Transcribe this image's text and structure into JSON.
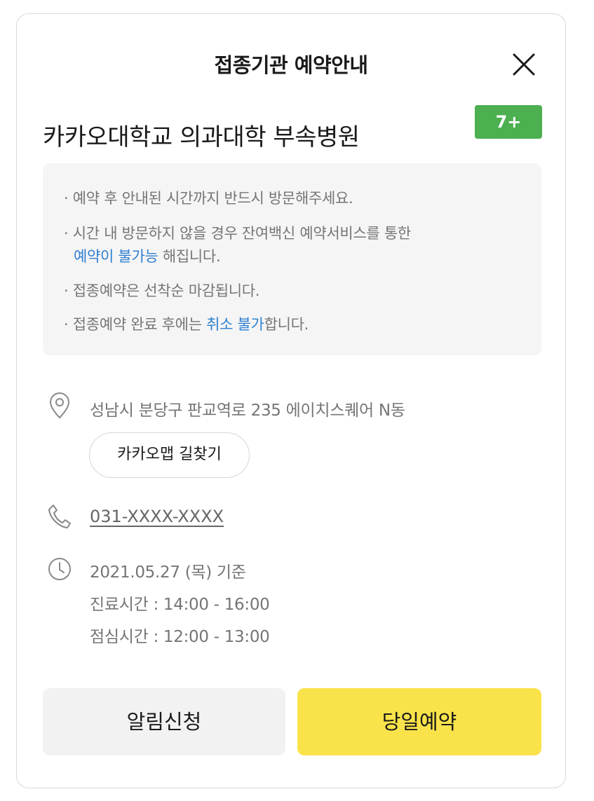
{
  "modal": {
    "title": "접종기관 예약안내",
    "hospital_name": "카카오대학교 의과대학 부속병원",
    "age_badge": "7+",
    "notice": [
      {
        "bullet": "·",
        "parts": [
          "예약 후 안내된 시간까지 반드시 방문해주세요."
        ]
      },
      {
        "bullet": "·",
        "line1": "시간 내 방문하지 않을 경우 잔여백신 예약서비스를 통한",
        "highlight": "예약이 불가능",
        "rest": " 해집니다."
      },
      {
        "bullet": "·",
        "parts": [
          "접종예약은 선착순 마감됩니다."
        ]
      },
      {
        "bullet": "·",
        "prefix": "접종예약 완료 후에는 ",
        "highlight": "취소 불가",
        "suffix": "합니다."
      }
    ],
    "address": "성남시 분당구 판교역로 235 에이치스퀘어 N동",
    "map_button": "카카오맵 길찾기",
    "phone": "031-XXXX-XXXX",
    "date_basis": "2021.05.27 (목) 기준",
    "clinic_hours": "진료시간 : 14:00 - 16:00",
    "lunch_hours": "점심시간 : 12:00 - 13:00",
    "buttons": {
      "notify": "알림신청",
      "reserve": "당일예약"
    },
    "colors": {
      "badge": "#4caf50",
      "highlight": "#2f7fd1",
      "reserve_button": "#fae34a"
    }
  }
}
